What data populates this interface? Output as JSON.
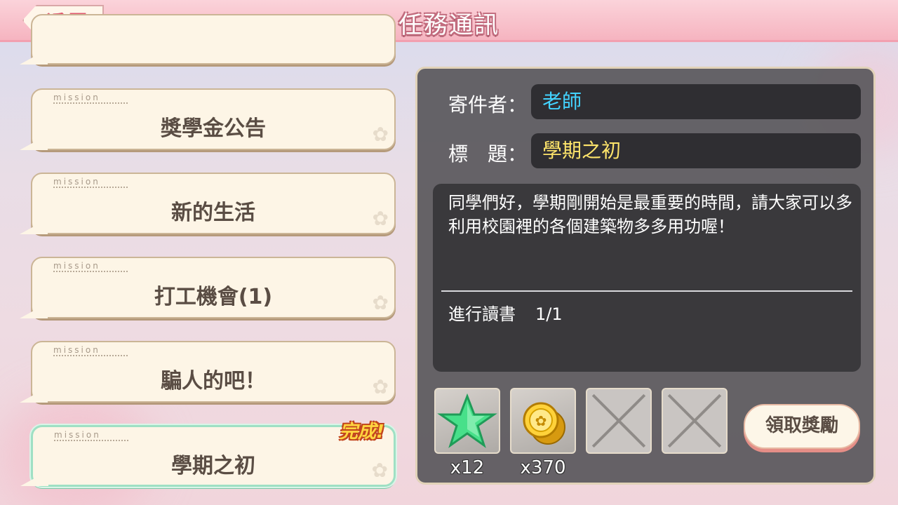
{
  "header": {
    "title": "任務通訊",
    "back_label": "返回"
  },
  "missions": [
    {
      "tag": "mission",
      "name": "獎學金公告",
      "selected": false
    },
    {
      "tag": "mission",
      "name": "新的生活",
      "selected": false
    },
    {
      "tag": "mission",
      "name": "打工機會(1)",
      "selected": false
    },
    {
      "tag": "mission",
      "name": "騙人的吧！",
      "selected": false
    },
    {
      "tag": "mission",
      "name": "學期之初",
      "selected": true,
      "badge": "完成!"
    }
  ],
  "detail": {
    "sender_label": "寄件者：",
    "sender": "老師",
    "subject_label": "標　題：",
    "subject": "學期之初",
    "message": "同學們好，學期剛開始是最重要的時間，請大家可以多利用校園裡的各個建築物多多用功喔！",
    "task_name": "進行讀書",
    "task_progress": "1/1"
  },
  "rewards": [
    {
      "icon": "green-star-icon",
      "count": "x12"
    },
    {
      "icon": "gold-coin-icon",
      "count": "x370"
    },
    {
      "icon": "empty-slot-icon",
      "count": ""
    },
    {
      "icon": "empty-slot-icon",
      "count": ""
    }
  ],
  "claim_label": "領取獎勵",
  "colors": {
    "sender": "#43d3ff",
    "subject": "#ffe56b",
    "accent_pink": "#f6b4c0",
    "selected_border": "#9fe0c4"
  }
}
